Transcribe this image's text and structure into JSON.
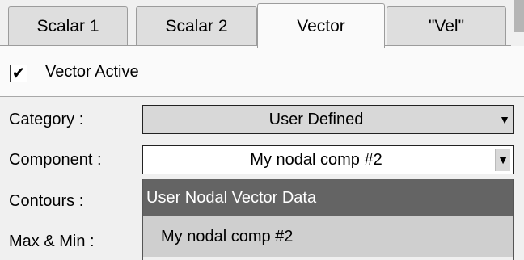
{
  "tabs": [
    {
      "label": "Scalar 1",
      "active": false
    },
    {
      "label": "Scalar 2",
      "active": false
    },
    {
      "label": "Vector",
      "active": true
    },
    {
      "label": "\"Vel\"",
      "active": false
    }
  ],
  "vector_active": {
    "label": "Vector Active",
    "checked": true,
    "check_glyph": "✔"
  },
  "fields": {
    "category_label": "Category :",
    "category_value": "User Defined",
    "component_label": "Component :",
    "component_value": "My nodal comp #2",
    "contours_label": "Contours :",
    "maxmin_label": "Max & Min :"
  },
  "dropdown_list": {
    "header": "User Nodal Vector Data",
    "items": [
      "My nodal comp #2"
    ]
  },
  "icons": {
    "dropdown_arrow": "▼"
  }
}
